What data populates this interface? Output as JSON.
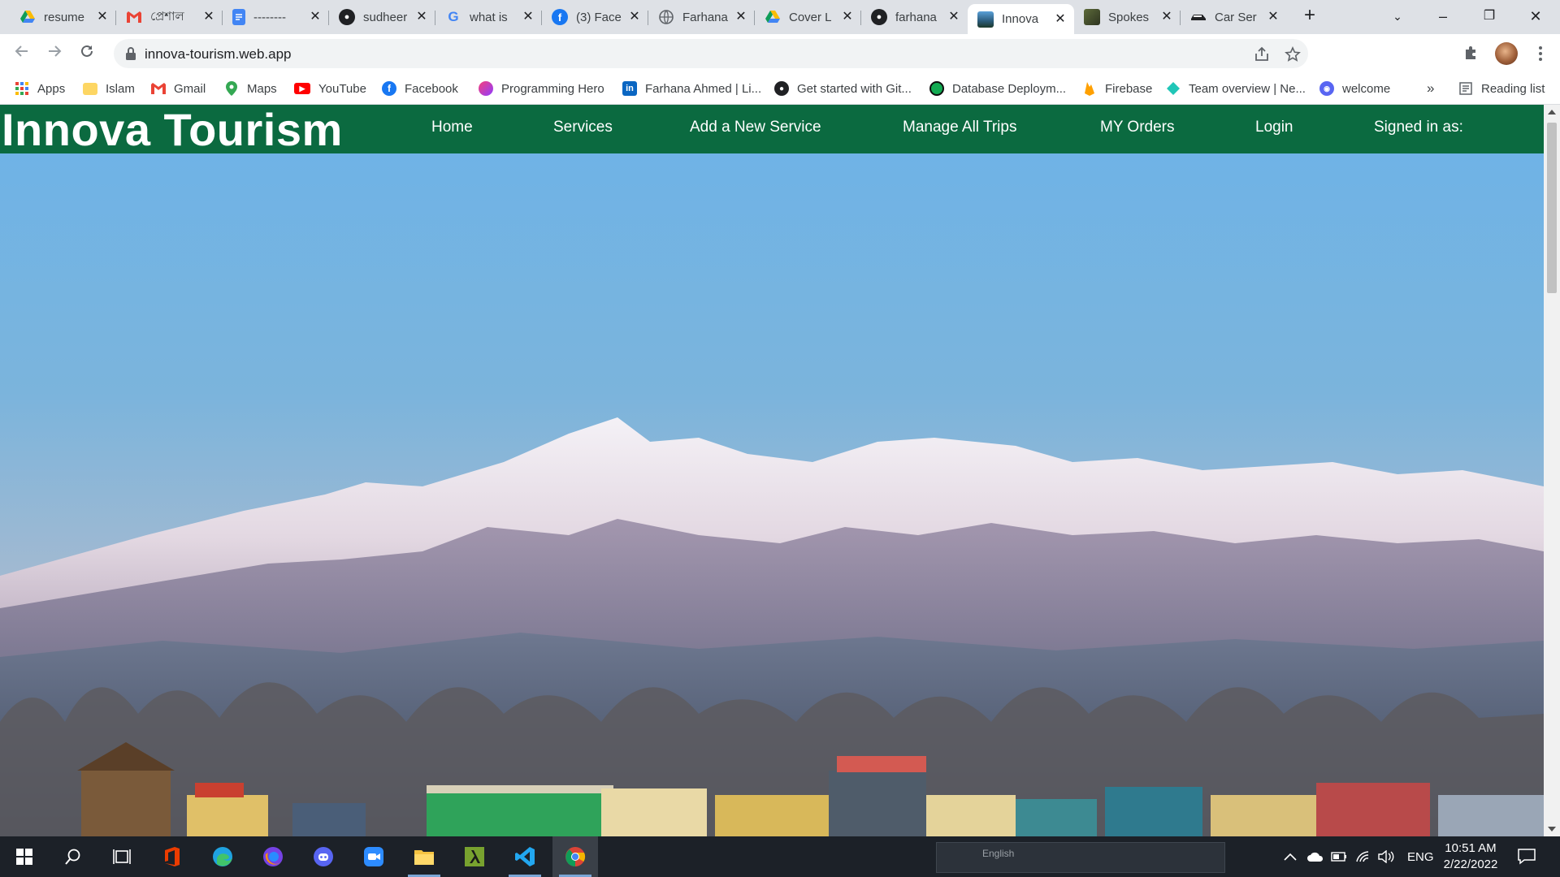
{
  "browser": {
    "tabs": [
      {
        "title": "resume",
        "icon": "google-drive-icon",
        "active": false
      },
      {
        "title": "প্রেশাল",
        "icon": "gmail-icon",
        "active": false
      },
      {
        "title": "--------",
        "icon": "google-docs-icon",
        "active": false
      },
      {
        "title": "sudheer",
        "icon": "github-icon",
        "active": false
      },
      {
        "title": "what is",
        "icon": "google-icon",
        "active": false
      },
      {
        "title": "(3) Face",
        "icon": "facebook-icon",
        "active": false
      },
      {
        "title": "Farhana",
        "icon": "globe-icon",
        "active": false
      },
      {
        "title": "Cover L",
        "icon": "google-drive-icon",
        "active": false
      },
      {
        "title": "farhana",
        "icon": "github-icon",
        "active": false
      },
      {
        "title": "Innova",
        "icon": "innova-favicon",
        "active": true
      },
      {
        "title": "Spokes",
        "icon": "spokes-favicon",
        "active": false
      },
      {
        "title": "Car Ser",
        "icon": "car-favicon",
        "active": false
      }
    ],
    "address": "innova-tourism.web.app",
    "bookmarks": [
      {
        "label": "Apps",
        "icon": "apps-grid-icon"
      },
      {
        "label": "Islam",
        "icon": "folder-icon"
      },
      {
        "label": "Gmail",
        "icon": "gmail-icon"
      },
      {
        "label": "Maps",
        "icon": "maps-icon"
      },
      {
        "label": "YouTube",
        "icon": "youtube-icon"
      },
      {
        "label": "Facebook",
        "icon": "facebook-icon"
      },
      {
        "label": "Programming Hero",
        "icon": "programming-hero-icon"
      },
      {
        "label": "Farhana Ahmed | Li...",
        "icon": "linkedin-icon"
      },
      {
        "label": "Get started with Git...",
        "icon": "github-icon"
      },
      {
        "label": "Database Deploym...",
        "icon": "mongodb-icon"
      },
      {
        "label": "Firebase",
        "icon": "firebase-icon"
      },
      {
        "label": "Team overview | Ne...",
        "icon": "netlify-icon"
      },
      {
        "label": "welcome",
        "icon": "discord-icon"
      }
    ],
    "bookmarks_overflow": "»",
    "reading_list": "Reading list"
  },
  "site": {
    "brand": "Innova Tourism",
    "nav": [
      "Home",
      "Services",
      "Add a New Service",
      "Manage All Trips",
      "MY Orders",
      "Login",
      "Signed in as:"
    ],
    "hero_image": "snow-capped-mountains-lake-houseboats"
  },
  "taskbar": {
    "apps": [
      "windows-start-icon",
      "search-icon",
      "task-view-icon",
      "office-icon",
      "edge-icon",
      "firefox-icon",
      "discord-icon",
      "zoom-icon",
      "file-explorer-icon",
      "lambda-app-icon",
      "vscode-icon",
      "chrome-icon"
    ],
    "language_bar": "English",
    "lang": "ENG",
    "time": "10:51 AM",
    "date": "2/22/2022"
  },
  "colors": {
    "site_nav": "#0b6a40",
    "tab_strip": "#dee1e6",
    "taskbar": "#1c2128"
  }
}
